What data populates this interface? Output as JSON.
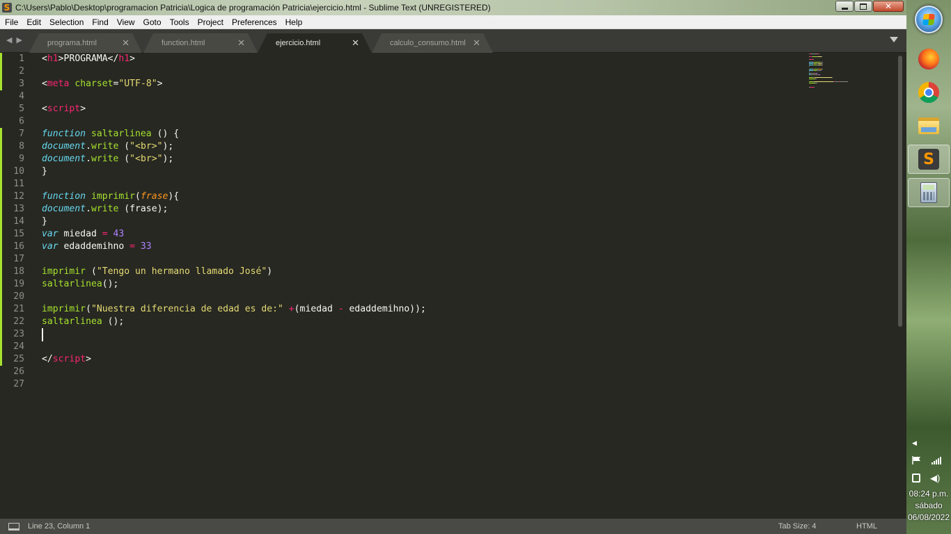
{
  "window": {
    "title": "C:\\Users\\Pablo\\Desktop\\programacion Patricia\\Logica de programación Patricia\\ejercicio.html - Sublime Text (UNREGISTERED)",
    "app_icon": "S"
  },
  "menu": [
    "File",
    "Edit",
    "Selection",
    "Find",
    "View",
    "Goto",
    "Tools",
    "Project",
    "Preferences",
    "Help"
  ],
  "tabs": [
    {
      "label": "programa.html",
      "active": false
    },
    {
      "label": "function.html",
      "active": false
    },
    {
      "label": "ejercicio.html",
      "active": true
    },
    {
      "label": "calculo_consumo.html",
      "active": false
    }
  ],
  "editor": {
    "line_numbers": [
      "1",
      "2",
      "3",
      "4",
      "5",
      "6",
      "7",
      "8",
      "9",
      "10",
      "11",
      "12",
      "13",
      "14",
      "15",
      "16",
      "17",
      "18",
      "19",
      "20",
      "21",
      "22",
      "23",
      "24",
      "25",
      "26",
      "27"
    ],
    "lines": [
      [
        [
          "pl",
          "<"
        ],
        [
          "tag",
          "h1"
        ],
        [
          "pl",
          ">PROGRAMA</"
        ],
        [
          "tag",
          "h1"
        ],
        [
          "pl",
          ">"
        ]
      ],
      [],
      [
        [
          "pl",
          "<"
        ],
        [
          "tag",
          "meta"
        ],
        [
          "pl",
          " "
        ],
        [
          "fn",
          "charset"
        ],
        [
          "pl",
          "="
        ],
        [
          "str",
          "\"UTF-8\""
        ],
        [
          "pl",
          ">"
        ]
      ],
      [],
      [
        [
          "pl",
          "<"
        ],
        [
          "tag",
          "script"
        ],
        [
          "pl",
          ">"
        ]
      ],
      [],
      [
        [
          "kw",
          "function"
        ],
        [
          "pl",
          " "
        ],
        [
          "fn",
          "saltarlinea"
        ],
        [
          "pl",
          " () {"
        ]
      ],
      [
        [
          "kw",
          "document"
        ],
        [
          "pl",
          "."
        ],
        [
          "fn",
          "write"
        ],
        [
          "pl",
          " ("
        ],
        [
          "str",
          "\"<br>\""
        ],
        [
          "pl",
          ");"
        ]
      ],
      [
        [
          "kw",
          "document"
        ],
        [
          "pl",
          "."
        ],
        [
          "fn",
          "write"
        ],
        [
          "pl",
          " ("
        ],
        [
          "str",
          "\"<br>\""
        ],
        [
          "pl",
          ");"
        ]
      ],
      [
        [
          "pl",
          "}"
        ]
      ],
      [],
      [
        [
          "kw",
          "function"
        ],
        [
          "pl",
          " "
        ],
        [
          "fn",
          "imprimir"
        ],
        [
          "pl",
          "("
        ],
        [
          "par",
          "frase"
        ],
        [
          "pl",
          "){"
        ]
      ],
      [
        [
          "kw",
          "document"
        ],
        [
          "pl",
          "."
        ],
        [
          "fn",
          "write"
        ],
        [
          "pl",
          " (frase);"
        ]
      ],
      [
        [
          "pl",
          "}"
        ]
      ],
      [
        [
          "kw",
          "var"
        ],
        [
          "pl",
          " miedad "
        ],
        [
          "op",
          "="
        ],
        [
          "pl",
          " "
        ],
        [
          "num",
          "43"
        ]
      ],
      [
        [
          "kw",
          "var"
        ],
        [
          "pl",
          " edaddemihno "
        ],
        [
          "op",
          "="
        ],
        [
          "pl",
          " "
        ],
        [
          "num",
          "33"
        ]
      ],
      [],
      [
        [
          "fn",
          "imprimir"
        ],
        [
          "pl",
          " ("
        ],
        [
          "str",
          "\"Tengo un hermano llamado José\""
        ],
        [
          "pl",
          ")"
        ]
      ],
      [
        [
          "fn",
          "saltarlinea"
        ],
        [
          "pl",
          "();"
        ]
      ],
      [],
      [
        [
          "fn",
          "imprimir"
        ],
        [
          "pl",
          "("
        ],
        [
          "str",
          "\"Nuestra diferencia de edad es de:\""
        ],
        [
          "pl",
          " "
        ],
        [
          "op",
          "+"
        ],
        [
          "pl",
          "(miedad "
        ],
        [
          "op",
          "-"
        ],
        [
          "pl",
          " edaddemihno));"
        ]
      ],
      [
        [
          "fn",
          "saltarlinea"
        ],
        [
          "pl",
          " ();"
        ]
      ],
      [],
      [],
      [
        [
          "pl",
          "</"
        ],
        [
          "tag",
          "script"
        ],
        [
          "pl",
          ">"
        ]
      ],
      [],
      []
    ],
    "cursor": {
      "line": 23,
      "column": 1
    }
  },
  "status": {
    "position": "Line 23, Column 1",
    "tab_size": "Tab Size: 4",
    "syntax": "HTML"
  },
  "taskbar": {
    "apps": [
      "firefox-icon",
      "chrome-icon",
      "file-explorer-icon",
      "sublime-text-icon",
      "calculator-icon"
    ],
    "clock_time": "08:24 p.m.",
    "clock_day": "sábado",
    "clock_date": "06/08/2022"
  },
  "colors": {
    "editor_bg": "#272822",
    "keyword": "#66d9ef",
    "function": "#a6e22e",
    "tag": "#f92672",
    "string": "#e6db74",
    "number": "#ae81ff",
    "parameter": "#fd971f"
  }
}
